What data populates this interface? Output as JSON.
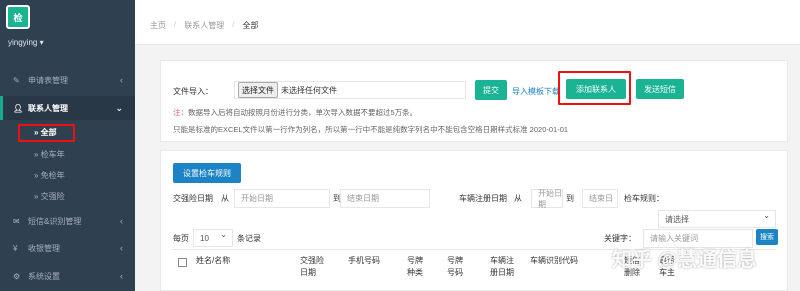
{
  "app": {
    "logo_text": "检",
    "user": "yingying ▾"
  },
  "sidebar": {
    "items": [
      {
        "label": "申请表管理",
        "icon": "edit-icon"
      },
      {
        "label": "联系人管理",
        "icon": "user-icon"
      },
      {
        "label": "短信&识别管理",
        "icon": "envelope-icon"
      },
      {
        "label": "收银管理",
        "icon": "yen-icon"
      },
      {
        "label": "系统设置",
        "icon": "gear-icon"
      }
    ],
    "subitems": [
      {
        "label": "» 全部"
      },
      {
        "label": "» 检车年"
      },
      {
        "label": "» 免检年"
      },
      {
        "label": "» 交强险"
      }
    ]
  },
  "breadcrumb": {
    "home": "主页",
    "section": "联系人管理",
    "current": "全部"
  },
  "import": {
    "label": "文件导入：",
    "choose_button": "选择文件",
    "no_file": "未选择任何文件",
    "submit": "提交",
    "template_link": "导入模板下载",
    "add_contact": "添加联系人",
    "send_sms": "发送短信",
    "note_star": "注：",
    "note1": "数据导入后将自动按照月份进行分类，单次导入数据不要超过5万条。",
    "note2": "只能是标准的EXCEL文件以第一行作为列名，所以第一行中不能是纯数字列名中不能包含空格日期样式标准 2020-01-01"
  },
  "filters": {
    "set_rule": "设置检车规则",
    "insurance_date": "交强险日期",
    "from": "从",
    "to": "到",
    "start_placeholder": "开始日期",
    "end_placeholder": "结束日期",
    "reg_date": "车辆注册日期",
    "reg_start": "开始日期",
    "reg_end": "结束日",
    "rule_label": "检车规则：",
    "select_default": "请选择"
  },
  "table": {
    "per_page": "每页",
    "page_size": "10",
    "records": "条记录",
    "keyword_label": "关键字：",
    "keyword_placeholder": "请输入关键词",
    "search": "搜索",
    "headers": [
      "姓名/名称",
      "交强险日期",
      "手机号码",
      "号牌种类",
      "号牌号码",
      "车辆注册日期",
      "车辆识别代码",
      "短信删除",
      "是否车主"
    ]
  },
  "watermark": "知乎 @慧通信息",
  "colors": {
    "sidebar": "#2f4050",
    "accent": "#1ab394",
    "blue": "#1c84c6",
    "highlight": "#e11111"
  }
}
